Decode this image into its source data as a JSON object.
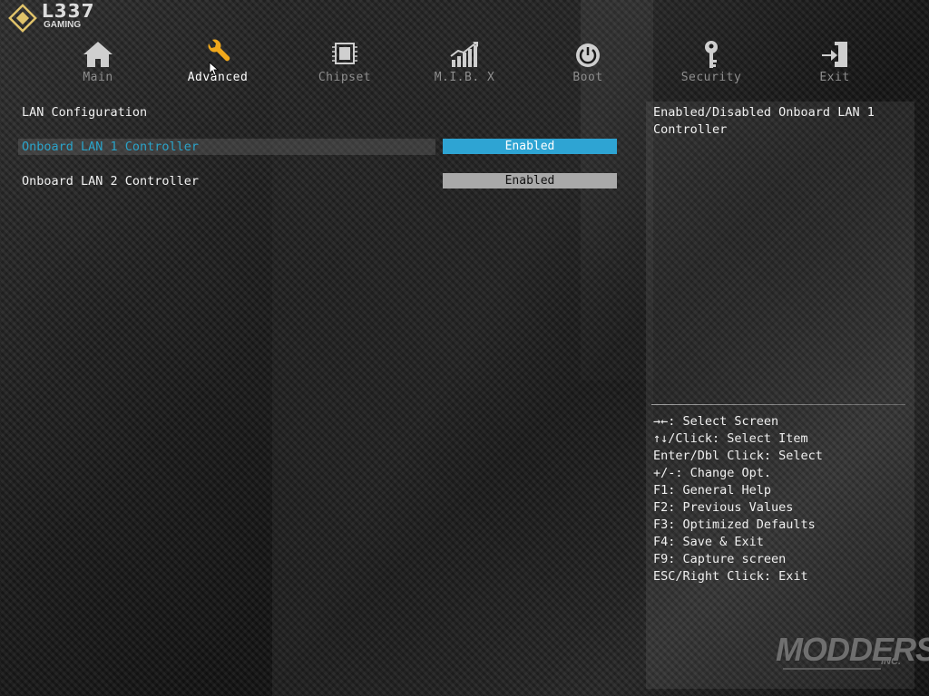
{
  "logo": {
    "main": "L337",
    "sub": "GAMING"
  },
  "nav": {
    "tabs": [
      {
        "label": "Main",
        "icon": "home-icon",
        "active": false
      },
      {
        "label": "Advanced",
        "icon": "wrench-icon",
        "active": true
      },
      {
        "label": "Chipset",
        "icon": "chip-icon",
        "active": false
      },
      {
        "label": "M.I.B. X",
        "icon": "performance-chart-icon",
        "active": false
      },
      {
        "label": "Boot",
        "icon": "power-icon",
        "active": false
      },
      {
        "label": "Security",
        "icon": "key-icon",
        "active": false
      },
      {
        "label": "Exit",
        "icon": "exit-door-icon",
        "active": false
      }
    ]
  },
  "settings": {
    "section_title": "LAN Configuration",
    "items": [
      {
        "label": "Onboard LAN 1 Controller",
        "value": "Enabled",
        "selected": true
      },
      {
        "label": "Onboard LAN 2 Controller",
        "value": "Enabled",
        "selected": false
      }
    ]
  },
  "help": {
    "description": "Enabled/Disabled Onboard LAN 1 Controller",
    "keys": [
      "→←: Select Screen",
      "↑↓/Click: Select Item",
      "Enter/Dbl Click: Select",
      "+/-: Change Opt.",
      "F1: General Help",
      "F2: Previous Values",
      "F3: Optimized Defaults",
      "F4: Save & Exit",
      "F9: Capture screen",
      "ESC/Right Click: Exit"
    ]
  },
  "watermark": {
    "main": "MODDERS",
    "sub": "INC."
  },
  "colors": {
    "accent": "#2ea4d3",
    "active_icon": "#f0a81c",
    "inactive_icon": "#cfcfcf",
    "selected_label": "#2aa3c9"
  }
}
